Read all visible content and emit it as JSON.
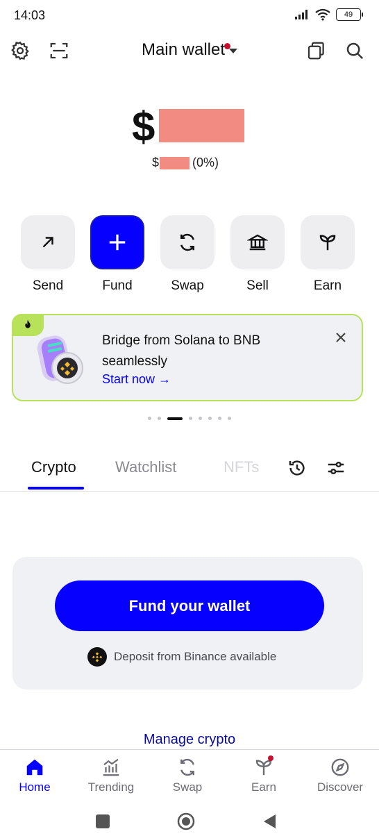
{
  "status_bar": {
    "time": "14:03",
    "battery": "49"
  },
  "header": {
    "title": "Main wallet",
    "icons": [
      "gear-icon",
      "scan-icon",
      "copy-icon",
      "search-icon"
    ]
  },
  "balance": {
    "currency_symbol": "$",
    "change_symbol": "$",
    "change_percent": "(0%)"
  },
  "actions": [
    {
      "label": "Send",
      "icon": "arrow-up-right-icon"
    },
    {
      "label": "Fund",
      "icon": "plus-icon"
    },
    {
      "label": "Swap",
      "icon": "swap-icon"
    },
    {
      "label": "Sell",
      "icon": "bank-icon"
    },
    {
      "label": "Earn",
      "icon": "sprout-icon"
    }
  ],
  "banner": {
    "title": "Bridge from Solana to BNB seamlessly",
    "cta": "Start now →",
    "accent": "#b7e25a"
  },
  "tabs": [
    {
      "label": "Crypto",
      "active": true
    },
    {
      "label": "Watchlist",
      "active": false
    },
    {
      "label": "NFTs",
      "active": false
    }
  ],
  "fund_card": {
    "button_label": "Fund your wallet",
    "deposit_text": "Deposit from Binance available"
  },
  "manage_link": "Manage crypto",
  "bottom_nav": [
    {
      "label": "Home",
      "icon": "home-icon",
      "active": true
    },
    {
      "label": "Trending",
      "icon": "chart-icon",
      "active": false
    },
    {
      "label": "Swap",
      "icon": "swap-icon",
      "active": false
    },
    {
      "label": "Earn",
      "icon": "sprout-icon",
      "active": false
    },
    {
      "label": "Discover",
      "icon": "compass-icon",
      "active": false
    }
  ],
  "colors": {
    "brand": "#0500ff",
    "notification": "#c8102e",
    "redaction": "#f28b82"
  }
}
